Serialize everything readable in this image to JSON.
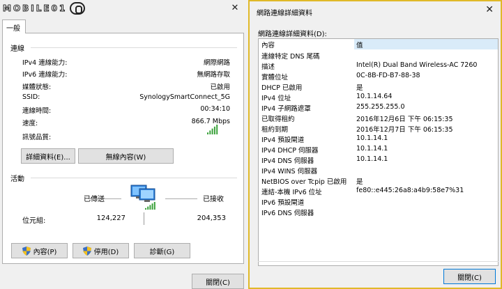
{
  "left": {
    "watermark": "MOBILE01",
    "close_glyph": "✕",
    "tab": "一般",
    "connection_title": "連線",
    "rows": [
      {
        "key": "IPv4 連線能力:",
        "value": "網際網路"
      },
      {
        "key": "IPv6 連線能力:",
        "value": "無網路存取"
      },
      {
        "key": "媒體狀態:",
        "value": "已啟用"
      },
      {
        "key": "SSID:",
        "value": "SynologySmartConnect_5G"
      },
      {
        "key": "連線時間:",
        "value": "00:34:10"
      },
      {
        "key": "速度:",
        "value": "866.7 Mbps"
      }
    ],
    "signal_label": "訊號品質:",
    "details_button": "詳細資料(E)...",
    "wireless_button": "無線內容(W)",
    "activity_title": "活動",
    "sent_label": "已傳送",
    "received_label": "已接收",
    "bytes_label": "位元組:",
    "bytes_sent": "124,227",
    "bytes_received": "204,353",
    "properties_button": "內容(P)",
    "disable_button": "停用(D)",
    "diagnose_button": "診斷(G)",
    "close_button": "關閉(C)"
  },
  "right": {
    "title": "網路連線詳細資料",
    "close_glyph": "✕",
    "list_label": "網路連線詳細資料(D):",
    "col_property": "內容",
    "col_value": "值",
    "rows": [
      {
        "p": "連線特定 DNS 尾碼",
        "v": ""
      },
      {
        "p": "描述",
        "v": "Intel(R) Dual Band Wireless-AC 7260"
      },
      {
        "p": "實體位址",
        "v": "0C-8B-FD-B7-88-38"
      },
      {
        "p": "DHCP 已啟用",
        "v": "是"
      },
      {
        "p": "IPv4 位址",
        "v": "10.1.14.64"
      },
      {
        "p": "IPv4 子網路遮罩",
        "v": "255.255.255.0"
      },
      {
        "p": "已取得租約",
        "v": "2016年12月6日 下午 06:15:35"
      },
      {
        "p": "租約到期",
        "v": "2016年12月7日 下午 06:15:35"
      },
      {
        "p": "IPv4 預設閘道",
        "v": "10.1.14.1"
      },
      {
        "p": "IPv4 DHCP 伺服器",
        "v": "10.1.14.1"
      },
      {
        "p": "IPv4 DNS 伺服器",
        "v": "10.1.14.1"
      },
      {
        "p": "IPv4 WINS 伺服器",
        "v": ""
      },
      {
        "p": "NetBIOS over Tcpip 已啟用",
        "v": "是"
      },
      {
        "p": "連結-本機 IPv6 位址",
        "v": "fe80::e445:26a8:a4b9:58e7%31"
      },
      {
        "p": "IPv6 預設閘道",
        "v": ""
      },
      {
        "p": "IPv6 DNS 伺服器",
        "v": ""
      }
    ],
    "close_button": "關閉(C)"
  },
  "colors": {
    "accent_border": "#e0b928",
    "selected_header": "#d9ebf9",
    "signal_green": "#3aa13a"
  },
  "signal_bars_lit": 5,
  "signal_bars_total": 5
}
